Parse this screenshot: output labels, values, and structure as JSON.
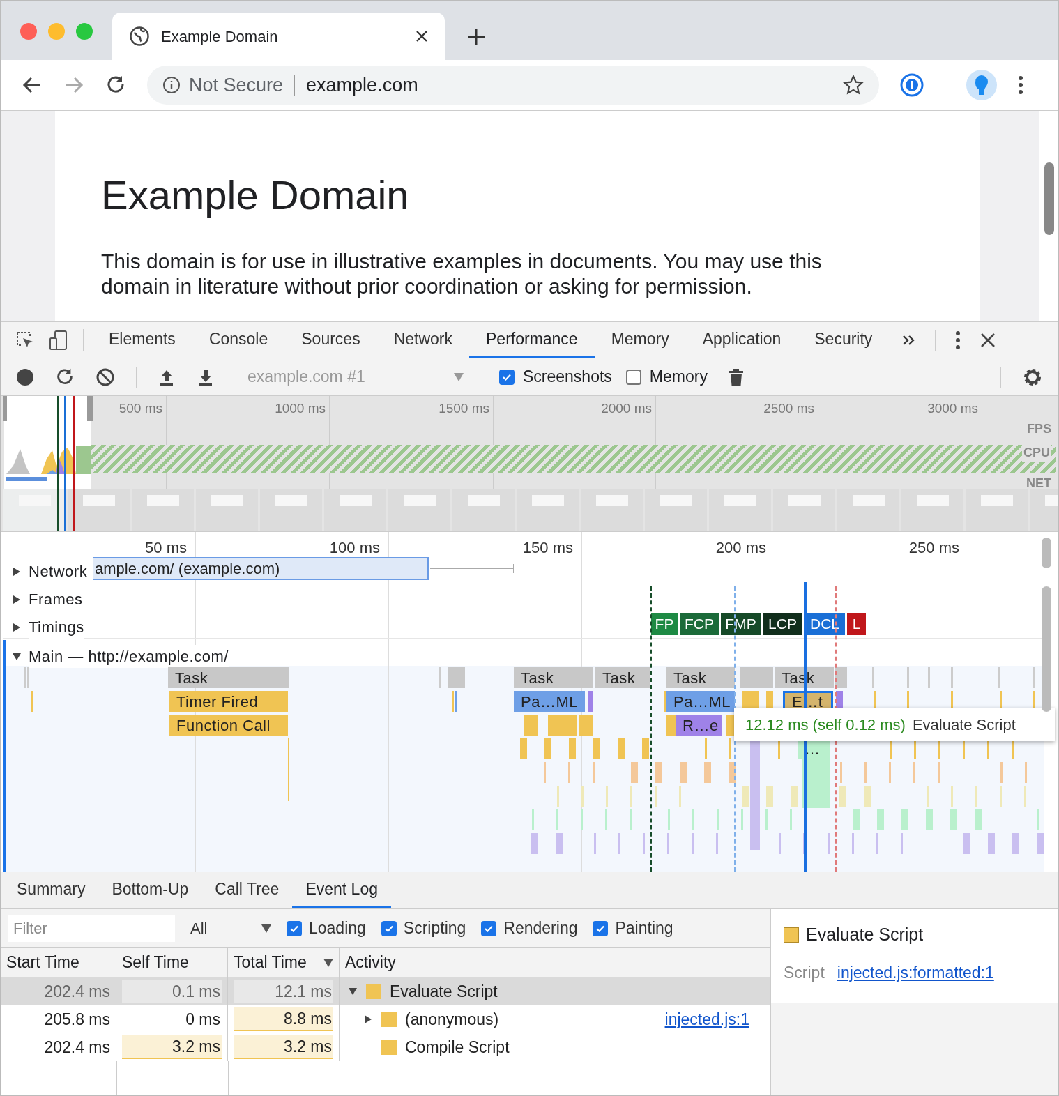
{
  "browser": {
    "tab_title": "Example Domain",
    "security": "Not Secure",
    "url": "example.com"
  },
  "page": {
    "heading": "Example Domain",
    "paragraph": "This domain is for use in illustrative examples in documents. You may use this domain in literature without prior coordination or asking for permission."
  },
  "devtools": {
    "tabs": [
      {
        "label": "Elements",
        "selected": false
      },
      {
        "label": "Console",
        "selected": false
      },
      {
        "label": "Sources",
        "selected": false
      },
      {
        "label": "Network",
        "selected": false
      },
      {
        "label": "Performance",
        "selected": true
      },
      {
        "label": "Memory",
        "selected": false
      },
      {
        "label": "Application",
        "selected": false
      },
      {
        "label": "Security",
        "selected": false
      }
    ],
    "toolbar": {
      "recording": "example.com #1",
      "checkboxes": [
        {
          "label": "Screenshots",
          "checked": true
        },
        {
          "label": "Memory",
          "checked": false
        }
      ]
    },
    "overview": {
      "time_labels": [
        "500 ms",
        "1000 ms",
        "1500 ms",
        "2000 ms",
        "2500 ms",
        "3000 ms"
      ],
      "track_labels": [
        "FPS",
        "CPU",
        "NET"
      ]
    },
    "flame": {
      "ruler": [
        "50 ms",
        "100 ms",
        "150 ms",
        "200 ms",
        "250 ms"
      ],
      "tracks": [
        {
          "label": "Network",
          "expanded": false
        },
        {
          "label": "Frames",
          "expanded": false
        },
        {
          "label": "Timings",
          "expanded": false
        },
        {
          "label": "Main — http://example.com/",
          "expanded": true
        }
      ],
      "network_request": "ample.com/ (example.com)",
      "timings": [
        {
          "label": "FP",
          "color": "#1e8a44"
        },
        {
          "label": "FCP",
          "color": "#1b6a39"
        },
        {
          "label": "FMP",
          "color": "#164a28"
        },
        {
          "label": "LCP",
          "color": "#112e1c"
        },
        {
          "label": "DCL",
          "color": "#1a6fd6"
        },
        {
          "label": "L",
          "color": "#c0171b"
        }
      ],
      "events": [
        {
          "label": "Task",
          "color": "#c8c8c8",
          "selected": false
        },
        {
          "label": "Task",
          "color": "#c8c8c8",
          "selected": false
        },
        {
          "label": "Task",
          "color": "#c8c8c8",
          "selected": false
        },
        {
          "label": "Task",
          "color": "#c8c8c8",
          "selected": false
        },
        {
          "label": "Task",
          "color": "#c8c8c8",
          "selected": false
        },
        {
          "label": "Timer Fired",
          "color": "#f0c453",
          "selected": false
        },
        {
          "label": "Pa…ML",
          "color": "#6e9fe6",
          "selected": false
        },
        {
          "label": "Pa…ML",
          "color": "#6e9fe6",
          "selected": false
        },
        {
          "label": "E…t",
          "color": "#d4b46c",
          "selected": true
        },
        {
          "label": "Function Call",
          "color": "#f0c453",
          "selected": false
        },
        {
          "label": "R…e",
          "color": "#9f82e8",
          "selected": false
        },
        {
          "label": "…",
          "color": "#b9f0cd",
          "selected": false
        }
      ],
      "tooltip": {
        "duration": "12.12 ms (self 0.12 ms)",
        "name": "Evaluate Script"
      }
    },
    "bottom": {
      "tabs": [
        {
          "label": "Summary",
          "selected": false
        },
        {
          "label": "Bottom-Up",
          "selected": false
        },
        {
          "label": "Call Tree",
          "selected": false
        },
        {
          "label": "Event Log",
          "selected": true
        }
      ],
      "filter": {
        "placeholder": "Filter",
        "select": "All"
      },
      "categories": [
        {
          "label": "Loading",
          "checked": true
        },
        {
          "label": "Scripting",
          "checked": true
        },
        {
          "label": "Rendering",
          "checked": true
        },
        {
          "label": "Painting",
          "checked": true
        }
      ],
      "columns": [
        {
          "label": "Start Time",
          "sorted": false
        },
        {
          "label": "Self Time",
          "sorted": false
        },
        {
          "label": "Total Time",
          "sorted": true
        },
        {
          "label": "Activity",
          "sorted": false
        }
      ],
      "rows": [
        {
          "start": "202.4 ms",
          "self": {
            "text": "0.1 ms",
            "highlighted": true
          },
          "total": {
            "text": "12.1 ms",
            "highlighted": true
          },
          "activity": "Evaluate Script",
          "color": "#f0c453",
          "selected": true,
          "expanded": true,
          "children": [
            {
              "start": "205.8 ms",
              "self": {
                "text": "0 ms",
                "highlighted": false
              },
              "total": {
                "text": "8.8 ms",
                "highlighted": true
              },
              "activity": "(anonymous)",
              "color": "#f0c453",
              "selected": false,
              "expanded": false,
              "link": "injected.js:1"
            },
            {
              "start": "202.4 ms",
              "self": {
                "text": "3.2 ms",
                "highlighted": true
              },
              "total": {
                "text": "3.2 ms",
                "highlighted": true
              },
              "activity": "Compile Script",
              "color": "#f0c453",
              "selected": false
            }
          ]
        }
      ],
      "details": {
        "title": "Evaluate Script",
        "color": "#f0c453",
        "field": "Script",
        "link": "injected.js:formatted:1"
      }
    }
  }
}
